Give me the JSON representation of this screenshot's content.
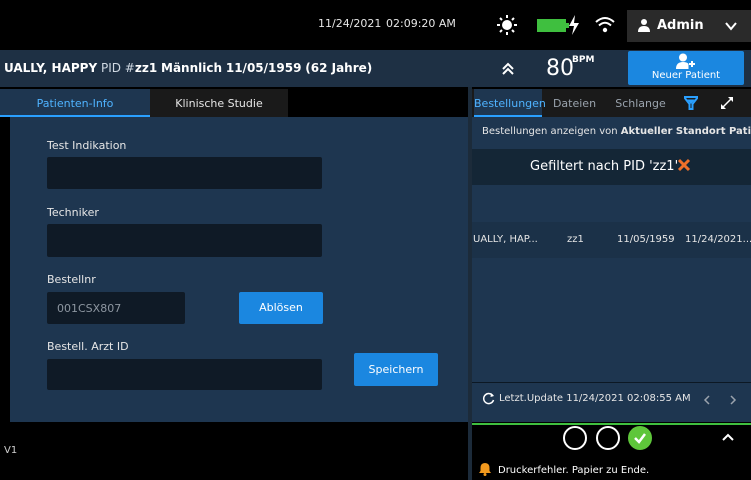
{
  "status": {
    "date": "11/24/2021",
    "time": "02:09:20 AM",
    "user_label": "Admin"
  },
  "patient": {
    "name": "UALLY, HAPPY",
    "pid_label": "PID #",
    "pid": "zz1",
    "sex": "Männlich",
    "dob": "11/05/1959",
    "age": "(62 Jahre)",
    "heart_rate": "80",
    "heart_rate_unit": "BPM",
    "new_patient_label": "Neuer Patient"
  },
  "left_tabs": [
    "Patienten-Info",
    "Klinische Studie"
  ],
  "form": {
    "test_indication_label": "Test Indikation",
    "test_indication_value": "",
    "technician_label": "Techniker",
    "technician_value": "",
    "order_no_label": "Bestellnr",
    "order_no_placeholder": "001CSX807",
    "release_button": "Ablösen",
    "ordering_doctor_label": "Bestell. Arzt ID",
    "ordering_doctor_value": "",
    "save_button": "Speichern"
  },
  "footer_left": {
    "version": "V1"
  },
  "right_tabs": [
    "Bestellungen",
    "Dateien",
    "Schlange"
  ],
  "orders": {
    "show_prefix": "Bestellungen anzeigen",
    "show_from": "von",
    "show_location": "Aktueller Standort Patient",
    "filter_text": "Gefiltert nach PID 'zz1'",
    "rows": [
      {
        "name": "UALLY, HAP...",
        "pid": "zz1",
        "dob": "11/05/1959",
        "date": "11/24/2021..."
      }
    ],
    "last_update": "Letzt.Update 11/24/2021 02:08:55 AM"
  },
  "alarm": {
    "message": "Druckerfehler. Papier zu Ende."
  },
  "colors": {
    "accent": "#1b87e0",
    "panel": "#1e3650",
    "field": "#0f1a26",
    "ok": "#5ec63a",
    "warning": "#f39a1e",
    "close_x": "#f0702a"
  },
  "icons": [
    "sun-icon",
    "battery-icon",
    "charging-bolt-icon",
    "wifi-icon",
    "person-icon",
    "chevron-down-icon",
    "double-chevron-up-icon",
    "add-person-icon",
    "filter-icon",
    "expand-icon",
    "close-icon",
    "refresh-icon",
    "chevron-left-icon",
    "chevron-right-icon",
    "chevron-up-icon",
    "bell-icon",
    "check-icon"
  ]
}
